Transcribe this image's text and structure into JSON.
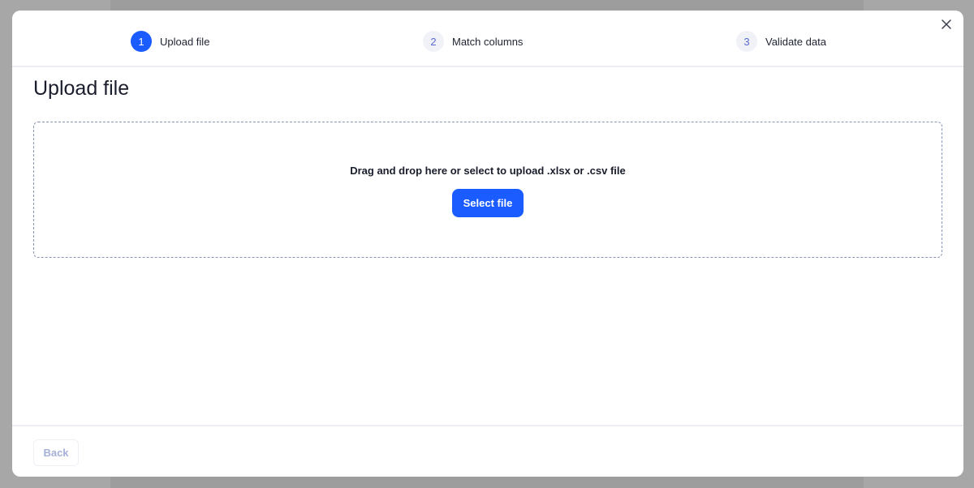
{
  "stepper": {
    "steps": [
      {
        "number": "1",
        "label": "Upload file",
        "state": "active"
      },
      {
        "number": "2",
        "label": "Match columns",
        "state": "inactive"
      },
      {
        "number": "3",
        "label": "Validate data",
        "state": "inactive"
      }
    ],
    "close_icon": "close-icon"
  },
  "main": {
    "title": "Upload file",
    "dropzone": {
      "text": "Drag and drop here or select to upload .xlsx or .csv file",
      "button_label": "Select file"
    }
  },
  "footer": {
    "back_label": "Back"
  },
  "colors": {
    "accent": "#1a5cff",
    "overlay": "#a7a7a7",
    "inactive_step_bg": "#f1f2f8",
    "inactive_step_text": "#5a6ad1",
    "disabled_text": "#a5b0d8"
  }
}
